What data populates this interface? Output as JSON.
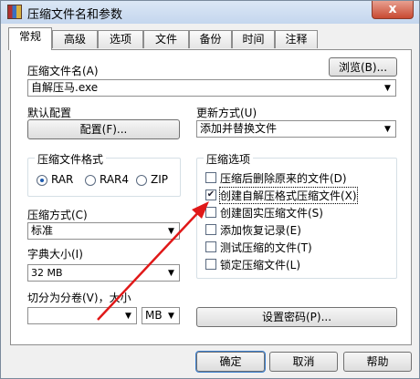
{
  "window": {
    "title": "压缩文件名和参数",
    "close_symbol": "x"
  },
  "tabs": [
    {
      "label": "常规",
      "active": true
    },
    {
      "label": "高级"
    },
    {
      "label": "选项"
    },
    {
      "label": "文件"
    },
    {
      "label": "备份"
    },
    {
      "label": "时间"
    },
    {
      "label": "注释"
    }
  ],
  "archive_name": {
    "label": "压缩文件名(A)",
    "value": "自解压马.exe",
    "browse_label": "浏览(B)..."
  },
  "default_profile": {
    "label": "默认配置",
    "button_label": "配置(F)..."
  },
  "update_mode": {
    "label": "更新方式(U)",
    "value": "添加并替换文件"
  },
  "archive_format": {
    "title": "压缩文件格式",
    "options": [
      "RAR",
      "RAR4",
      "ZIP"
    ],
    "selected": "RAR"
  },
  "compression_method": {
    "label": "压缩方式(C)",
    "value": "标准"
  },
  "dictionary_size": {
    "label": "字典大小(I)",
    "value": "32 MB"
  },
  "split_volumes": {
    "label": "切分为分卷(V)，大小",
    "value": "",
    "unit": "MB"
  },
  "options": {
    "title": "压缩选项",
    "items": [
      {
        "label": "压缩后删除原来的文件(D)",
        "checked": false
      },
      {
        "label": "创建自解压格式压缩文件(X)",
        "checked": true
      },
      {
        "label": "创建固实压缩文件(S)",
        "checked": false
      },
      {
        "label": "添加恢复记录(E)",
        "checked": false
      },
      {
        "label": "测试压缩的文件(T)",
        "checked": false
      },
      {
        "label": "锁定压缩文件(L)",
        "checked": false
      }
    ],
    "set_password_label": "设置密码(P)..."
  },
  "footer": {
    "ok_label": "确定",
    "cancel_label": "取消",
    "help_label": "帮助"
  },
  "colors": {
    "annotation_arrow": "#e01818",
    "accent": "#1d5bb0"
  }
}
